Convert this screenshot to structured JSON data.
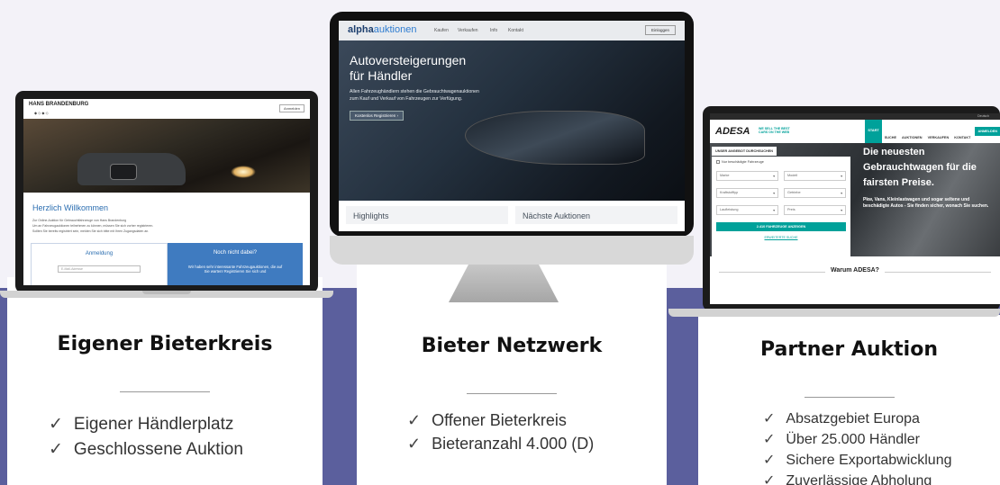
{
  "sections": [
    {
      "title": "Eigener Bieterkreis",
      "items": [
        "Eigener Händlerplatz",
        "Geschlossene Auktion"
      ]
    },
    {
      "title": "Bieter Netzwerk",
      "items": [
        "Offener Bieterkreis",
        "Bieteranzahl 4.000 (D)"
      ]
    },
    {
      "title": "Partner Auktion",
      "items": [
        "Absatzgebiet Europa",
        "Über 25.000 Händler",
        "Sichere Exportabwicklung",
        "Zuverlässige Abholung"
      ]
    }
  ],
  "site1": {
    "brand": "HANS BRANDENBURG",
    "login_btn": "Anmelden",
    "welcome": "Herzlich Willkommen",
    "intro1": "Zur Online-Auktion für Gebrauchtfahrzeuge von Hans Brandenburg",
    "intro2": "Um an Fahrzeugauktionen teilnehmen zu können, müssen Sie sich vorher registrieren.",
    "intro3": "Sollten Sie bereits registriert sein, melden Sie sich bitte mit Ihren Zugangsdaten an.",
    "login_title": "Anmeldung",
    "email_placeholder": "E-Mail-Adresse",
    "notyet_title": "Noch nicht dabei?",
    "notyet_text": "Wir haben sehr interessante Fahrzeugauktionen, die auf Sie warten! Registrieren Sie sich und"
  },
  "site2": {
    "logo_a": "alpha",
    "logo_b": "auktionen",
    "nav": [
      "Kaufen",
      "Verkaufen",
      "Info",
      "Kontakt"
    ],
    "login_btn": "Einloggen",
    "hero1": "Autoversteigerungen",
    "hero2": "für Händler",
    "sub1": "Allen Fahrzeughändlern stehen die Gebrauchtwagenauktionen",
    "sub2": "zum Kauf und Verkauf von Fahrzeugen zur Verfügung.",
    "cta": "Kostenlos Registrieren",
    "card1": "Highlights",
    "card2": "Nächste Auktionen"
  },
  "site3": {
    "logo": "ADESA",
    "tagline1": "WE SELL THE BEST",
    "tagline2": "CARS ON THE WEB",
    "topbar": "Deutsch",
    "nav": [
      "START",
      "SUCHE",
      "AUKTIONEN",
      "VERKAUFEN",
      "KONTAKT",
      "ANMELDEN"
    ],
    "search_tab": "UNSER ANGEBOT DURCHSUCHEN",
    "damaged_label": "Nur beschädigte Fahrzeuge",
    "fields": [
      "Marke",
      "Modell",
      "Kraftstofftyp",
      "Getriebe",
      "Laufleistung",
      "Preis"
    ],
    "submit": "2.410 FAHRZEUGE ANZEIGEN",
    "extended": "ERWEITERTE SUCHE",
    "hero1": "Die neuesten",
    "hero2": "Gebrauchtwagen für die",
    "hero3": "fairsten Preise.",
    "hero_sub": "Pkw, Vans, Kleinlastwagen und sogar seltene und beschädigte Autos - Sie finden sicher, wonach Sie suchen.",
    "why": "Warum ADESA?"
  },
  "colors": {
    "band": "#5b5f9d",
    "adesa_green": "#00a19a",
    "alpha_blue": "#1d3f6e"
  }
}
